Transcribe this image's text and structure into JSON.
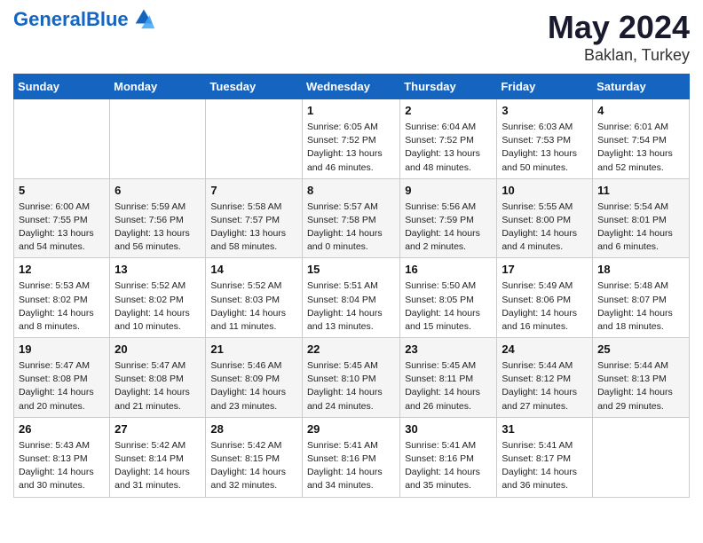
{
  "header": {
    "logo_line1": "General",
    "logo_line2": "Blue",
    "main_title": "May 2024",
    "subtitle": "Baklan, Turkey"
  },
  "days_of_week": [
    "Sunday",
    "Monday",
    "Tuesday",
    "Wednesday",
    "Thursday",
    "Friday",
    "Saturday"
  ],
  "weeks": [
    [
      {
        "day": "",
        "info": ""
      },
      {
        "day": "",
        "info": ""
      },
      {
        "day": "",
        "info": ""
      },
      {
        "day": "1",
        "info": "Sunrise: 6:05 AM\nSunset: 7:52 PM\nDaylight: 13 hours\nand 46 minutes."
      },
      {
        "day": "2",
        "info": "Sunrise: 6:04 AM\nSunset: 7:52 PM\nDaylight: 13 hours\nand 48 minutes."
      },
      {
        "day": "3",
        "info": "Sunrise: 6:03 AM\nSunset: 7:53 PM\nDaylight: 13 hours\nand 50 minutes."
      },
      {
        "day": "4",
        "info": "Sunrise: 6:01 AM\nSunset: 7:54 PM\nDaylight: 13 hours\nand 52 minutes."
      }
    ],
    [
      {
        "day": "5",
        "info": "Sunrise: 6:00 AM\nSunset: 7:55 PM\nDaylight: 13 hours\nand 54 minutes."
      },
      {
        "day": "6",
        "info": "Sunrise: 5:59 AM\nSunset: 7:56 PM\nDaylight: 13 hours\nand 56 minutes."
      },
      {
        "day": "7",
        "info": "Sunrise: 5:58 AM\nSunset: 7:57 PM\nDaylight: 13 hours\nand 58 minutes."
      },
      {
        "day": "8",
        "info": "Sunrise: 5:57 AM\nSunset: 7:58 PM\nDaylight: 14 hours\nand 0 minutes."
      },
      {
        "day": "9",
        "info": "Sunrise: 5:56 AM\nSunset: 7:59 PM\nDaylight: 14 hours\nand 2 minutes."
      },
      {
        "day": "10",
        "info": "Sunrise: 5:55 AM\nSunset: 8:00 PM\nDaylight: 14 hours\nand 4 minutes."
      },
      {
        "day": "11",
        "info": "Sunrise: 5:54 AM\nSunset: 8:01 PM\nDaylight: 14 hours\nand 6 minutes."
      }
    ],
    [
      {
        "day": "12",
        "info": "Sunrise: 5:53 AM\nSunset: 8:02 PM\nDaylight: 14 hours\nand 8 minutes."
      },
      {
        "day": "13",
        "info": "Sunrise: 5:52 AM\nSunset: 8:02 PM\nDaylight: 14 hours\nand 10 minutes."
      },
      {
        "day": "14",
        "info": "Sunrise: 5:52 AM\nSunset: 8:03 PM\nDaylight: 14 hours\nand 11 minutes."
      },
      {
        "day": "15",
        "info": "Sunrise: 5:51 AM\nSunset: 8:04 PM\nDaylight: 14 hours\nand 13 minutes."
      },
      {
        "day": "16",
        "info": "Sunrise: 5:50 AM\nSunset: 8:05 PM\nDaylight: 14 hours\nand 15 minutes."
      },
      {
        "day": "17",
        "info": "Sunrise: 5:49 AM\nSunset: 8:06 PM\nDaylight: 14 hours\nand 16 minutes."
      },
      {
        "day": "18",
        "info": "Sunrise: 5:48 AM\nSunset: 8:07 PM\nDaylight: 14 hours\nand 18 minutes."
      }
    ],
    [
      {
        "day": "19",
        "info": "Sunrise: 5:47 AM\nSunset: 8:08 PM\nDaylight: 14 hours\nand 20 minutes."
      },
      {
        "day": "20",
        "info": "Sunrise: 5:47 AM\nSunset: 8:08 PM\nDaylight: 14 hours\nand 21 minutes."
      },
      {
        "day": "21",
        "info": "Sunrise: 5:46 AM\nSunset: 8:09 PM\nDaylight: 14 hours\nand 23 minutes."
      },
      {
        "day": "22",
        "info": "Sunrise: 5:45 AM\nSunset: 8:10 PM\nDaylight: 14 hours\nand 24 minutes."
      },
      {
        "day": "23",
        "info": "Sunrise: 5:45 AM\nSunset: 8:11 PM\nDaylight: 14 hours\nand 26 minutes."
      },
      {
        "day": "24",
        "info": "Sunrise: 5:44 AM\nSunset: 8:12 PM\nDaylight: 14 hours\nand 27 minutes."
      },
      {
        "day": "25",
        "info": "Sunrise: 5:44 AM\nSunset: 8:13 PM\nDaylight: 14 hours\nand 29 minutes."
      }
    ],
    [
      {
        "day": "26",
        "info": "Sunrise: 5:43 AM\nSunset: 8:13 PM\nDaylight: 14 hours\nand 30 minutes."
      },
      {
        "day": "27",
        "info": "Sunrise: 5:42 AM\nSunset: 8:14 PM\nDaylight: 14 hours\nand 31 minutes."
      },
      {
        "day": "28",
        "info": "Sunrise: 5:42 AM\nSunset: 8:15 PM\nDaylight: 14 hours\nand 32 minutes."
      },
      {
        "day": "29",
        "info": "Sunrise: 5:41 AM\nSunset: 8:16 PM\nDaylight: 14 hours\nand 34 minutes."
      },
      {
        "day": "30",
        "info": "Sunrise: 5:41 AM\nSunset: 8:16 PM\nDaylight: 14 hours\nand 35 minutes."
      },
      {
        "day": "31",
        "info": "Sunrise: 5:41 AM\nSunset: 8:17 PM\nDaylight: 14 hours\nand 36 minutes."
      },
      {
        "day": "",
        "info": ""
      }
    ]
  ]
}
